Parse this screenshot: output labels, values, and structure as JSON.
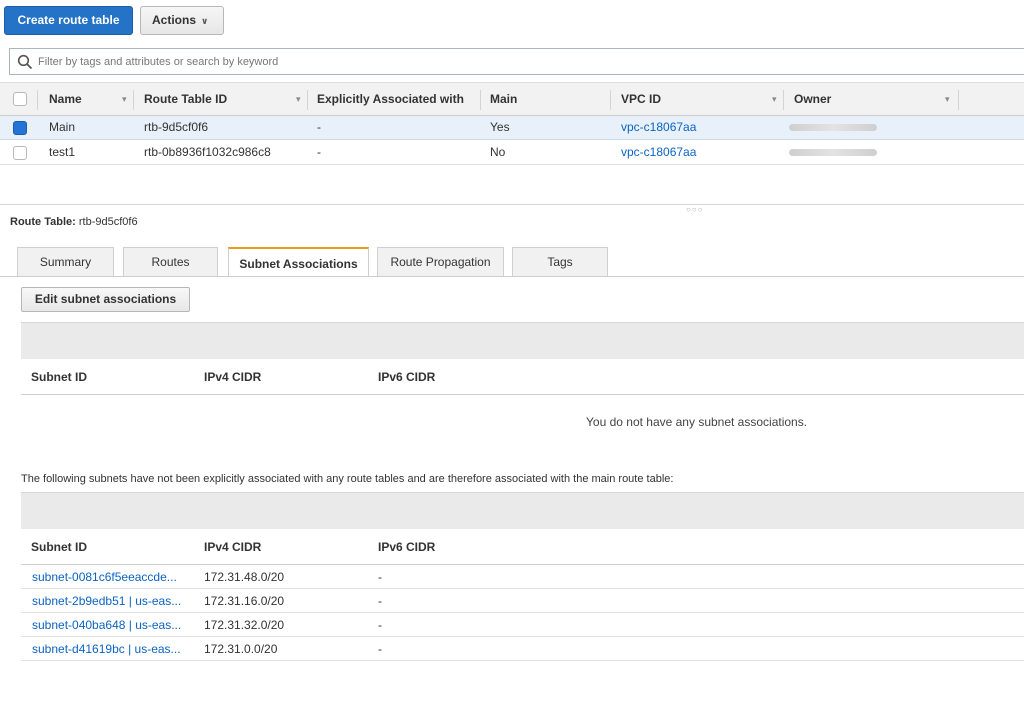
{
  "toolbar": {
    "create_label": "Create route table",
    "actions_label": "Actions"
  },
  "search": {
    "placeholder": "Filter by tags and attributes or search by keyword"
  },
  "table": {
    "columns": [
      "Name",
      "Route Table ID",
      "Explicitly Associated with",
      "Main",
      "VPC ID",
      "Owner"
    ],
    "rows": [
      {
        "name": "Main",
        "route_table_id": "rtb-9d5cf0f6",
        "explicit": "-",
        "main": "Yes",
        "vpc_id": "vpc-c18067aa",
        "selected": true
      },
      {
        "name": "test1",
        "route_table_id": "rtb-0b8936f1032c986c8",
        "explicit": "-",
        "main": "No",
        "vpc_id": "vpc-c18067aa",
        "selected": false
      }
    ]
  },
  "details": {
    "label_prefix": "Route Table:",
    "route_table_id": "rtb-9d5cf0f6",
    "tabs": [
      "Summary",
      "Routes",
      "Subnet Associations",
      "Route Propagation",
      "Tags"
    ],
    "active_tab": "Subnet Associations",
    "edit_button": "Edit subnet associations",
    "assoc_columns": [
      "Subnet ID",
      "IPv4 CIDR",
      "IPv6 CIDR"
    ],
    "empty_message": "You do not have any subnet associations.",
    "implicit_note": "The following subnets have not been explicitly associated with any route tables and are therefore associated with the main route table:",
    "implicit_columns": [
      "Subnet ID",
      "IPv4 CIDR",
      "IPv6 CIDR"
    ],
    "implicit_rows": [
      {
        "subnet": "subnet-0081c6f5eeaccde...",
        "ipv4": "172.31.48.0/20",
        "ipv6": "-"
      },
      {
        "subnet": "subnet-2b9edb51 | us-eas...",
        "ipv4": "172.31.16.0/20",
        "ipv6": "-"
      },
      {
        "subnet": "subnet-040ba648 | us-eas...",
        "ipv4": "172.31.32.0/20",
        "ipv6": "-"
      },
      {
        "subnet": "subnet-d41619bc | us-eas...",
        "ipv4": "172.31.0.0/20",
        "ipv6": "-"
      }
    ]
  },
  "colors": {
    "primary": "#2473c6",
    "link": "#0b63c4",
    "tab_accent": "#ec9b18",
    "selected_row": "#e8f0fa"
  }
}
